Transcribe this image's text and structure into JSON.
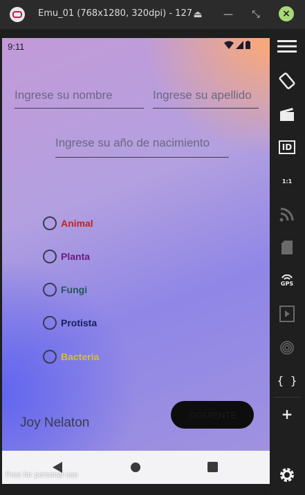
{
  "window": {
    "title": "Emu_01 (768x1280, 320dpi) - 127",
    "close_label": "×"
  },
  "statusbar": {
    "time": "9:11"
  },
  "form": {
    "nombre_placeholder": "Ingrese su nombre",
    "apellido_placeholder": "Ingrese su apellido",
    "anio_placeholder": "Ingrese su año de nacimiento"
  },
  "options": [
    {
      "label": "Animal",
      "color": "#c0231f"
    },
    {
      "label": "Planta",
      "color": "#6a1b7e"
    },
    {
      "label": "Fungi",
      "color": "#1e5a52"
    },
    {
      "label": "Protista",
      "color": "#14205c"
    },
    {
      "label": "Bacteria",
      "color": "#d6c12a"
    }
  ],
  "user_name": "Joy Nelaton",
  "next_button": "SIGUIENTE",
  "watermark": "Free for personal use",
  "sidebar": {
    "gps_label": "GPS",
    "id_label": "ID",
    "ratio_label": "1:1",
    "code_label": "{ }",
    "plus_label": "+"
  }
}
